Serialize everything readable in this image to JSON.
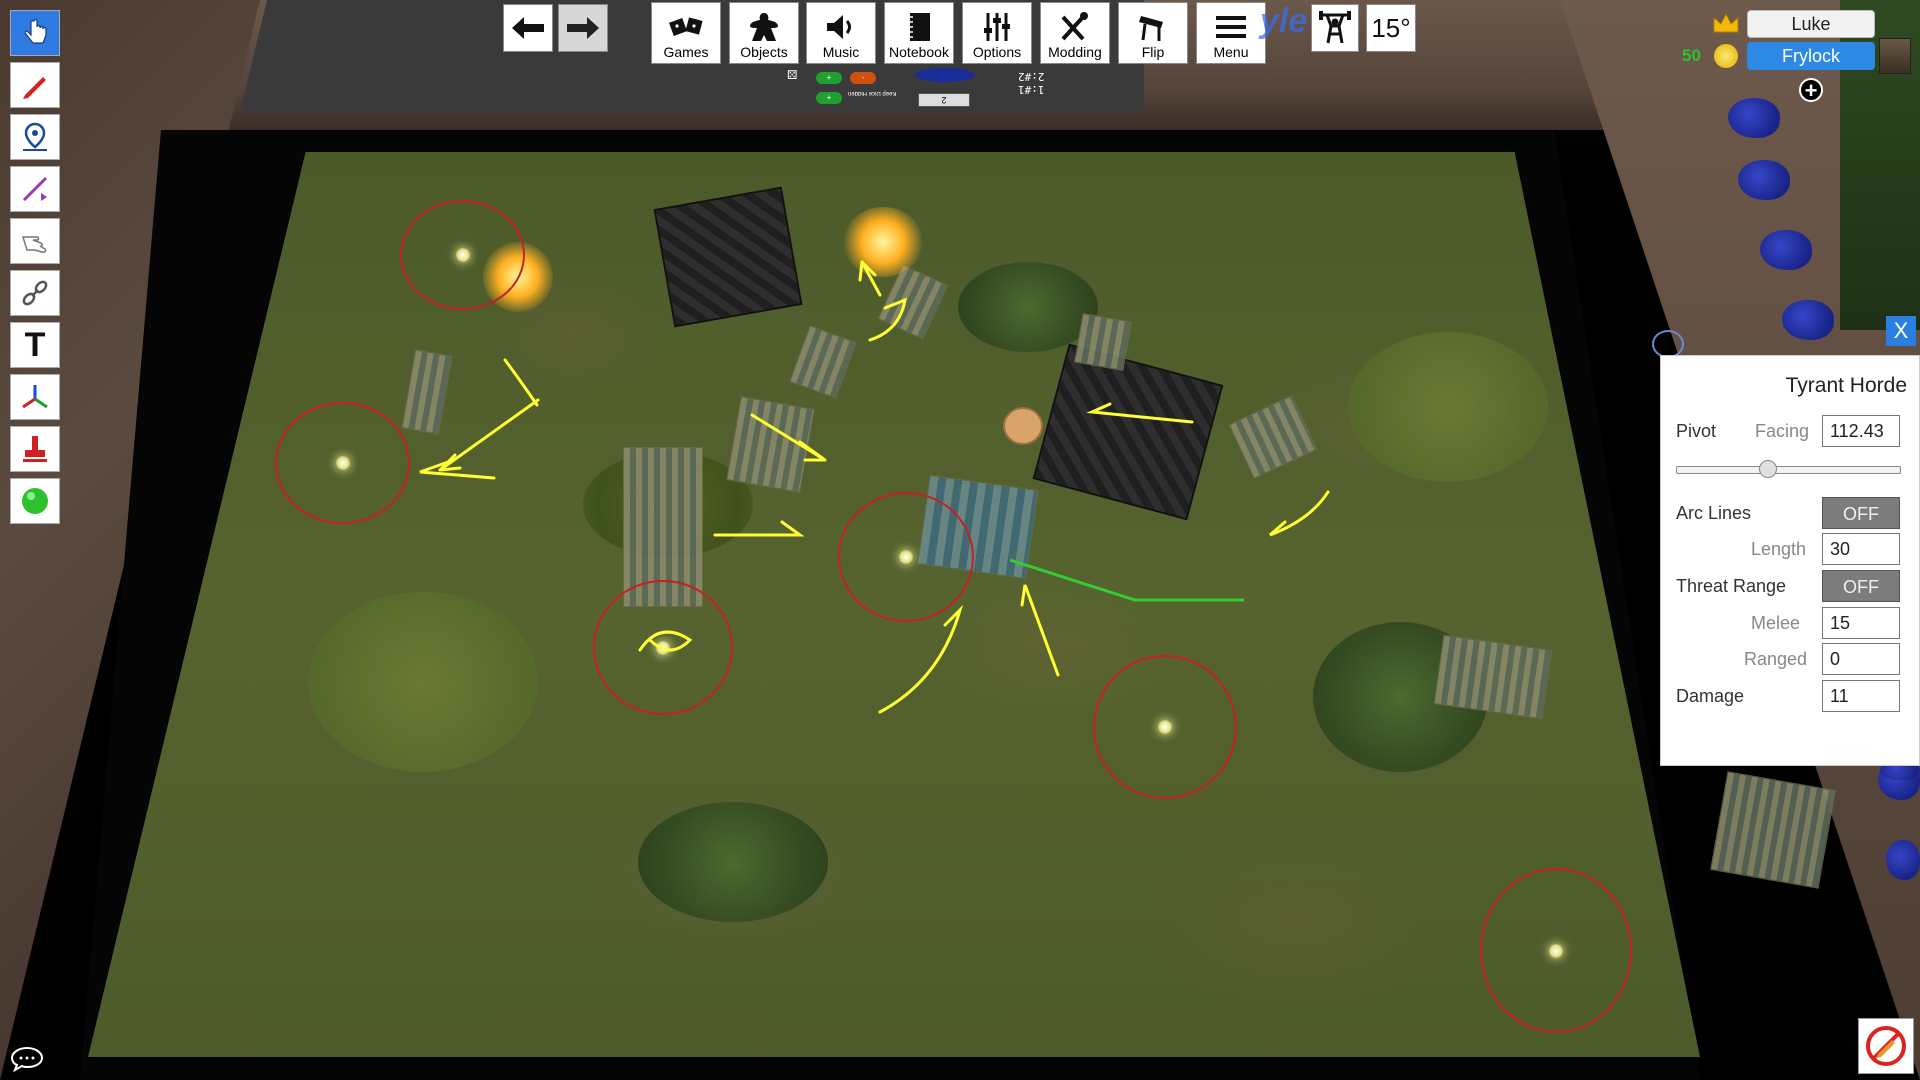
{
  "toolbar": {
    "tools": [
      {
        "name": "grab-tool",
        "icon": "pointer-hand-icon",
        "active": true
      },
      {
        "name": "pen-tool",
        "icon": "pen-icon"
      },
      {
        "name": "ping-tool",
        "icon": "map-pin-icon"
      },
      {
        "name": "line-tool",
        "icon": "measure-line-icon"
      },
      {
        "name": "flick-tool",
        "icon": "flick-hand-icon"
      },
      {
        "name": "joint-tool",
        "icon": "chain-icon"
      },
      {
        "name": "text-tool",
        "icon": "text-icon",
        "label": "T"
      },
      {
        "name": "gizmo-tool",
        "icon": "axis-gizmo-icon"
      },
      {
        "name": "snap-tool",
        "icon": "snap-stamp-icon"
      },
      {
        "name": "color-tool",
        "icon": "color-dot-icon"
      }
    ]
  },
  "menu": {
    "undo_icon": "arrow-left-icon",
    "redo_icon": "arrow-right-icon",
    "games": "Games",
    "objects": "Objects",
    "music": "Music",
    "notebook": "Notebook",
    "options": "Options",
    "modding": "Modding",
    "flip": "Flip",
    "menu": "Menu",
    "rotation": "15°",
    "ghost_text": "yle"
  },
  "players": {
    "luke": "Luke",
    "frylock": "Frylock",
    "coins": "50"
  },
  "panel": {
    "title": "Tyrant Horde",
    "pivot_label": "Pivot",
    "facing_label": "Facing",
    "facing_value": "112.43",
    "facing_fraction": 0.41,
    "arc_lines_label": "Arc Lines",
    "arc_lines_value": "OFF",
    "length_label": "Length",
    "length_value": "30",
    "threat_label": "Threat Range",
    "threat_value": "OFF",
    "melee_label": "Melee",
    "melee_value": "15",
    "ranged_label": "Ranged",
    "ranged_value": "0",
    "damage_label": "Damage",
    "damage_value": "11",
    "close_label": "X"
  },
  "notebook_mini": {
    "label": "1:#1\n2:#2",
    "keep": "Keep Dice Hidden",
    "box": "2",
    "btn1": "+",
    "btn2": "-",
    "btn3": "+"
  },
  "colors": {
    "accent": "#2f7ae0",
    "objective": "#c62020",
    "annotation": "#ffff33",
    "range_line": "#33cc33"
  }
}
